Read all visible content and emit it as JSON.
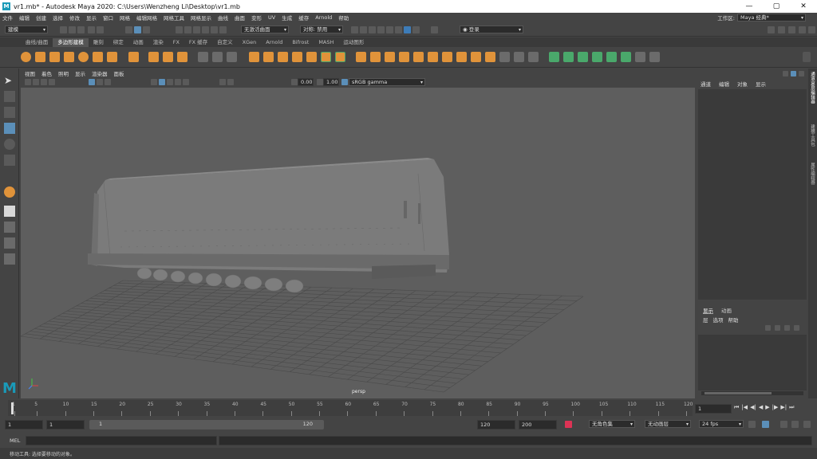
{
  "window": {
    "title": "vr1.mb* - Autodesk Maya 2020: C:\\Users\\Wenzheng Li\\Desktop\\vr1.mb",
    "min": "—",
    "max": "▢",
    "close": "✕"
  },
  "menu": {
    "items": [
      "文件",
      "编辑",
      "创建",
      "选择",
      "修改",
      "显示",
      "窗口",
      "网格",
      "编辑网格",
      "网格工具",
      "网格显示",
      "曲线",
      "曲面",
      "变形",
      "UV",
      "生成",
      "缓存",
      "Arnold",
      "帮助"
    ],
    "workspace_label": "工作区:",
    "workspace_value": "Maya 经典*"
  },
  "status": {
    "mode": "建模",
    "live_surface": "无激活曲面",
    "symmetry": "对称: 禁用",
    "login": "登录"
  },
  "shelf": {
    "tabs": [
      "曲线/曲面",
      "多边形建模",
      "雕刻",
      "绑定",
      "动画",
      "渲染",
      "FX",
      "FX 缓存",
      "自定义",
      "XGen",
      "Arnold",
      "Bifrost",
      "MASH",
      "运动图形"
    ],
    "active_tab": 1
  },
  "viewport": {
    "menu": [
      "视图",
      "着色",
      "照明",
      "显示",
      "渲染器",
      "面板"
    ],
    "exposure": "0.00",
    "gamma": "1.00",
    "color_space": "sRGB gamma",
    "camera_label": "persp"
  },
  "channelbox": {
    "menu": [
      "通道",
      "编辑",
      "对象",
      "显示"
    ],
    "layer_tabs": [
      "显示",
      "动画"
    ],
    "layer_menu": [
      "层",
      "选项",
      "帮助"
    ]
  },
  "side_tabs": [
    "通道盒/层编辑器",
    "建模工具包",
    "属性编辑器"
  ],
  "timeline": {
    "ticks": [
      "1",
      "5",
      "10",
      "15",
      "20",
      "25",
      "30",
      "35",
      "40",
      "45",
      "50",
      "55",
      "60",
      "65",
      "70",
      "75",
      "80",
      "85",
      "90",
      "95",
      "100",
      "105",
      "110",
      "115",
      "120"
    ],
    "current_frame": "1"
  },
  "range": {
    "start": "1",
    "anim_start": "1",
    "slider_start": "1",
    "slider_end": "120",
    "end": "120",
    "anim_end": "200",
    "character_set": "无角色集",
    "anim_layer": "无动画层",
    "fps": "24 fps"
  },
  "cmd": {
    "label": "MEL"
  },
  "help": {
    "text": "移动工具: 选择要移动的对象。"
  },
  "colors": {
    "accent": "#5b8fb9",
    "shelf_orange": "#e0933a",
    "shelf_green": "#4aa86b",
    "logo": "#1a9ab8"
  }
}
